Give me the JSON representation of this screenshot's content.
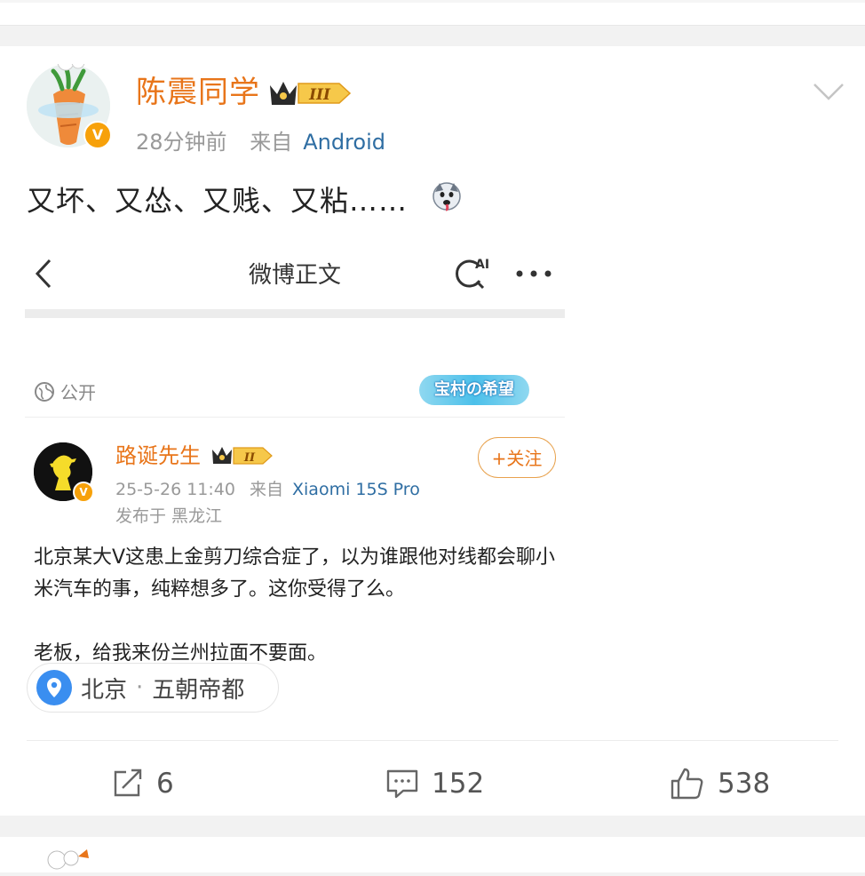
{
  "post": {
    "username": "陈震同学",
    "level_badge": "III",
    "time": "28分钟前",
    "source_prefix": "来自",
    "source": "Android",
    "text": "又坏、又怂、又贱、又粘……"
  },
  "embedded": {
    "nav_title": "微博正文",
    "ai_label": "AI",
    "visibility": "公开",
    "village_badge": "宝村の希望",
    "author": "路诞先生",
    "level_badge": "II",
    "time": "25-5-26 11:40",
    "source_prefix": "来自",
    "device": "Xiaomi 15S Pro",
    "location": "发布于 黑龙江",
    "follow_label": "+关注",
    "paragraphs": [
      "北京某大V这患上金剪刀综合症了，以为谁跟他对线都会聊小米汽车的事，纯粹想多了。这你受得了么。",
      "老板，给我来份兰州拉面不要面。"
    ]
  },
  "location_tag": {
    "city": "北京",
    "sep": "·",
    "name": "五朝帝都"
  },
  "actions": {
    "repost_count": "6",
    "comment_count": "152",
    "like_count": "538"
  },
  "colors": {
    "username": "#e8751a",
    "link": "#2f6ea3",
    "verified": "#f7a10a"
  }
}
